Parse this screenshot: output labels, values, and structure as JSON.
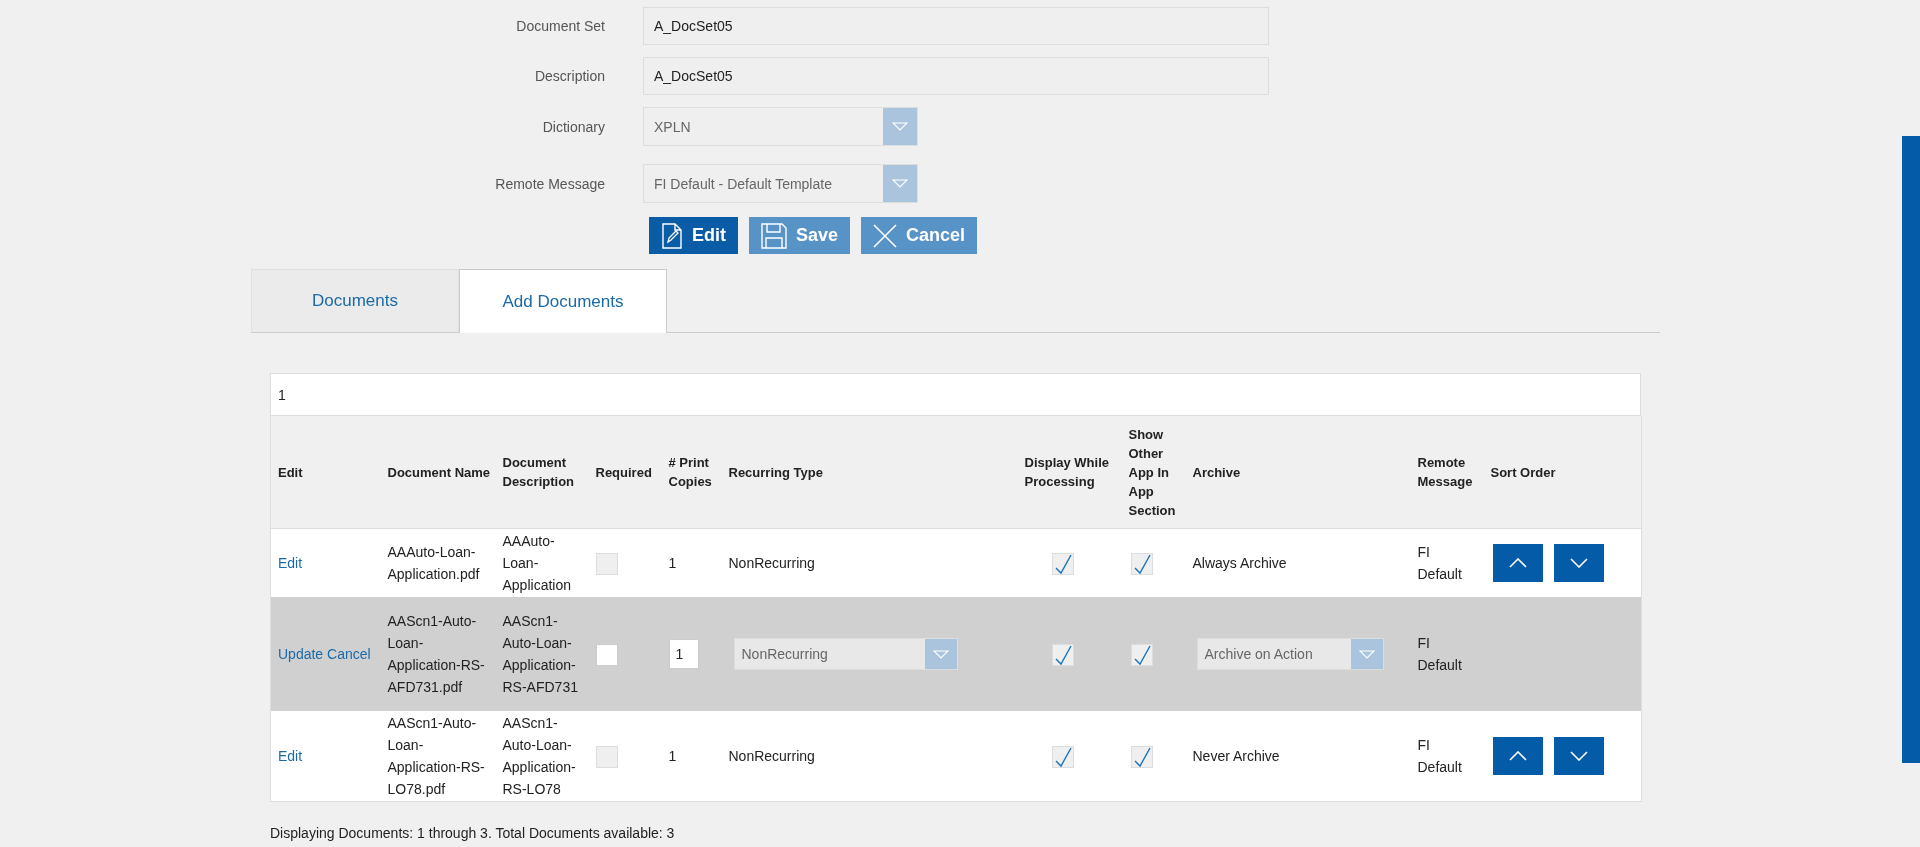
{
  "form": {
    "fields": [
      {
        "kind": "text",
        "label": "Document Set",
        "value": "A_DocSet05"
      },
      {
        "kind": "text",
        "label": "Description",
        "value": "A_DocSet05"
      },
      {
        "kind": "select",
        "label": "Dictionary",
        "value": "XPLN"
      },
      {
        "kind": "select",
        "label": "Remote Message",
        "value": "FI Default - Default Template"
      }
    ],
    "buttons": [
      {
        "kind": "edit",
        "label": "Edit",
        "disabled": false
      },
      {
        "kind": "save",
        "label": "Save",
        "disabled": true
      },
      {
        "kind": "cancel",
        "label": "Cancel",
        "disabled": true
      }
    ]
  },
  "tabs": [
    {
      "label": "Documents",
      "selected": false
    },
    {
      "label": "Add Documents",
      "selected": true
    }
  ],
  "table": {
    "pager": "1",
    "columns": [
      "Edit",
      "Document Name",
      "Document Description",
      "Required",
      "# Print Copies",
      "Recurring Type",
      "Display While Processing",
      "Show Other App In App Section",
      "Archive",
      "Remote Message",
      "Sort Order"
    ],
    "rows": [
      {
        "kind": "view",
        "actions": [
          "Edit"
        ],
        "document_name": "AAAuto-Loan-Application.pdf",
        "document_description": "AAAuto-Loan-Application",
        "required": false,
        "print_copies": "1",
        "recurring_type": "NonRecurring",
        "display_while_processing": true,
        "show_other_app": true,
        "archive": "Always Archive",
        "remote_message": "FI Default"
      },
      {
        "kind": "edit",
        "actions": [
          "Update",
          "Cancel"
        ],
        "document_name": "AAScn1-Auto-Loan-Application-RS-AFD731.pdf",
        "document_description": "AAScn1-Auto-Loan-Application-RS-AFD731",
        "required": false,
        "print_copies": "1",
        "recurring_type": "NonRecurring",
        "display_while_processing": true,
        "show_other_app": true,
        "archive": "Archive on Action",
        "remote_message": "FI Default"
      },
      {
        "kind": "view",
        "actions": [
          "Edit"
        ],
        "document_name": "AAScn1-Auto-Loan-Application-RS-LO78.pdf",
        "document_description": "AAScn1-Auto-Loan-Application-RS-LO78",
        "required": false,
        "print_copies": "1",
        "recurring_type": "NonRecurring",
        "display_while_processing": true,
        "show_other_app": true,
        "archive": "Never Archive",
        "remote_message": "FI Default"
      }
    ],
    "footer": "Displaying Documents: 1 through 3. Total Documents available: 3"
  }
}
